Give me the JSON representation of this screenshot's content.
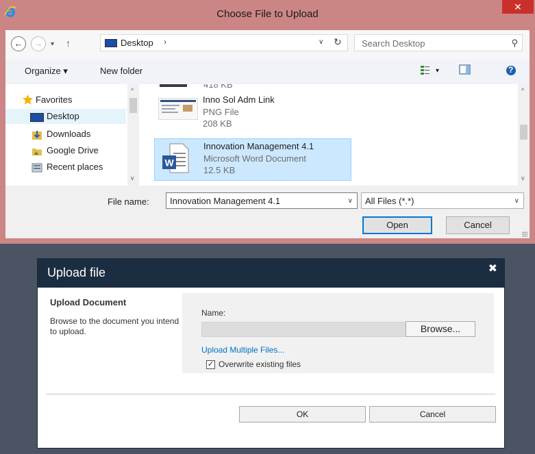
{
  "file_dialog": {
    "title": "Choose File to Upload",
    "close_glyph": "✕",
    "nav": {
      "back_glyph": "←",
      "forward_glyph": "→",
      "recent_glyph": "▾",
      "up_glyph": "↑",
      "address_location": "Desktop",
      "address_sep": "›",
      "address_dropdown_glyph": "∨",
      "refresh_glyph": "↻",
      "search_placeholder": "Search Desktop",
      "search_glyph": "⚲"
    },
    "toolbar": {
      "organize": "Organize ▾",
      "new_folder": "New folder",
      "view_dropdown_glyph": "▾",
      "help_glyph": "?"
    },
    "sidebar": {
      "items": [
        {
          "label": "Favorites",
          "icon": "star-icon"
        },
        {
          "label": "Desktop",
          "icon": "desktop-icon"
        },
        {
          "label": "Downloads",
          "icon": "downloads-icon"
        },
        {
          "label": "Google Drive",
          "icon": "folder-icon"
        },
        {
          "label": "Recent places",
          "icon": "recent-places-icon"
        }
      ]
    },
    "files": [
      {
        "name": "Inno Sol Adm Link",
        "type": "PNG File",
        "size": "208 KB"
      },
      {
        "name": "Innovation Management 4.1",
        "type": "Microsoft Word Document",
        "size": "12.5 KB"
      }
    ],
    "partial_row_text": "418 KB",
    "scroll_up_glyph": "^",
    "scroll_down_glyph": "v",
    "file_name_label": "File name:",
    "file_name_value": "Innovation Management 4.1",
    "file_type_value": "All Files (*.*)",
    "dropdown_glyph": "∨",
    "open_label": "Open",
    "cancel_label": "Cancel"
  },
  "upload_dialog": {
    "title": "Upload file",
    "close_glyph": "✖",
    "section_heading": "Upload Document",
    "section_description": "Browse to the document you intend to upload.",
    "name_label": "Name:",
    "name_value": "",
    "browse_label": "Browse...",
    "multiple_link": "Upload Multiple Files...",
    "overwrite_checked": true,
    "check_glyph": "✓",
    "overwrite_label": "Overwrite existing files",
    "ok_label": "OK",
    "cancel_label": "Cancel"
  },
  "colors": {
    "window_frame": "#cc8585",
    "close_button": "#c9302b",
    "selection": "#cce8ff",
    "upload_titlebar": "#1b2d40",
    "link": "#0072c6"
  }
}
